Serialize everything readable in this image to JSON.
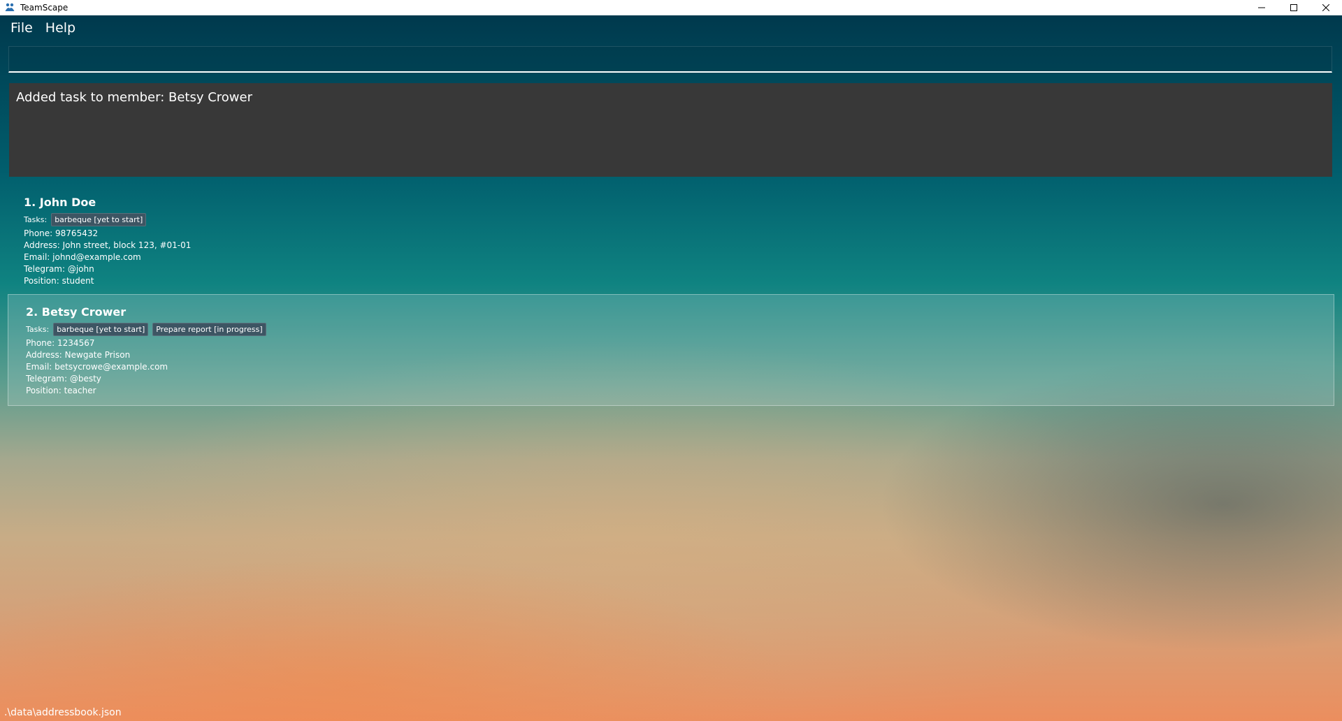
{
  "window": {
    "title": "TeamScape",
    "app_icon": "people-icon"
  },
  "menu": {
    "file": "File",
    "help": "Help"
  },
  "command": {
    "value": "",
    "placeholder": ""
  },
  "result": {
    "text": "Added task to member: Betsy Crower"
  },
  "persons": [
    {
      "index_name": "1. John Doe",
      "tasks_label": "Tasks:",
      "tasks": [
        "barbeque [yet to start]"
      ],
      "phone": "Phone: 98765432",
      "address": "Address: John street, block 123, #01-01",
      "email": "Email: johnd@example.com",
      "telegram": "Telegram: @john",
      "position": "Position: student"
    },
    {
      "index_name": "2. Betsy Crower",
      "tasks_label": "Tasks:",
      "tasks": [
        "barbeque [yet to start]",
        "Prepare report [in progress]"
      ],
      "phone": "Phone: 1234567",
      "address": "Address: Newgate Prison",
      "email": "Email: betsycrowe@example.com",
      "telegram": "Telegram: @besty",
      "position": "Position: teacher"
    }
  ],
  "status": {
    "path": ".\\data\\addressbook.json"
  }
}
